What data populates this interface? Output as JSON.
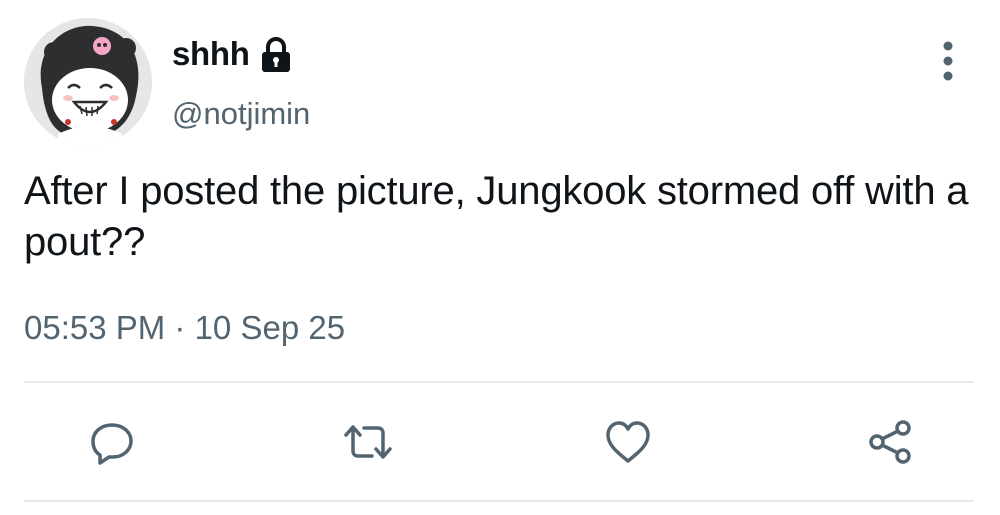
{
  "user": {
    "display_name": "shhh",
    "handle": "@notjimin",
    "protected_icon": "lock-icon",
    "avatar_icon": "kuromi-avatar"
  },
  "tweet": {
    "text": "After I posted the picture, Jungkook stormed off with a pout??",
    "timestamp": "05:53 PM · 10 Sep 25"
  },
  "actions": [
    {
      "name": "reply",
      "icon": "reply-icon"
    },
    {
      "name": "retweet",
      "icon": "retweet-icon"
    },
    {
      "name": "like",
      "icon": "heart-icon"
    },
    {
      "name": "share",
      "icon": "share-icon"
    }
  ],
  "colors": {
    "text": "#0f1419",
    "secondary": "#536471",
    "divider": "#e6e9eb"
  }
}
